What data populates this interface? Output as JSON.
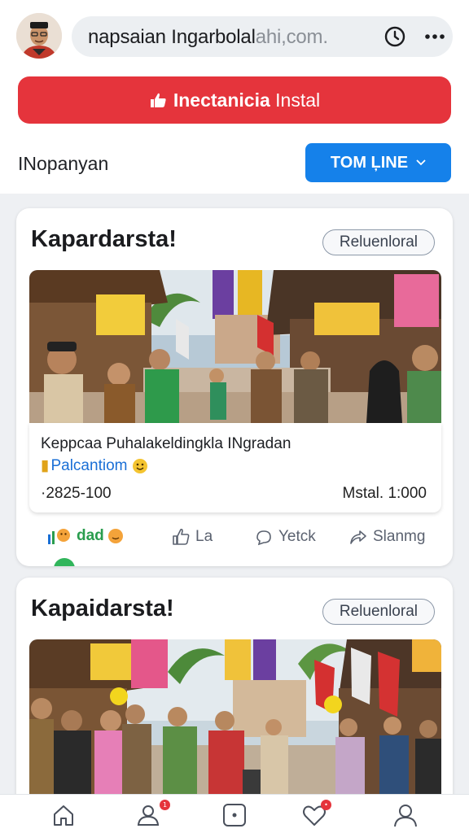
{
  "browser": {
    "url_main": "napsaian Ingarbolal",
    "url_dim": "ahi,com.",
    "icons": {
      "history": "clock-icon",
      "menu": "more-dots-icon"
    }
  },
  "install_button": {
    "label_bold": "Inectanicia",
    "label_light": "Instal",
    "icon": "thumbs-up-icon",
    "color": "#e5343c"
  },
  "filter": {
    "label": "INopanyan",
    "timeline_button": "TOM ĻINE",
    "timeline_color": "#1581ea"
  },
  "posts": [
    {
      "title": "Kapardarsta!",
      "tag": "Reluenloral",
      "caption": "Keppcaa Puhalakeldingkla INgradan",
      "location": "Palcantiom",
      "date": "·2825-100",
      "meta": "Mstal. 1:000",
      "actions": {
        "react": "dad",
        "like": "La",
        "comment": "Yetck",
        "share": "Slanmg"
      }
    },
    {
      "title": "Kapaidarsta!",
      "tag": "Reluenloral"
    }
  ],
  "bottom_nav": {
    "items": [
      "home-icon",
      "people-icon",
      "square-dot-icon",
      "heart-icon",
      "profile-icon"
    ],
    "badges": {
      "people": "1",
      "heart": "•"
    }
  }
}
